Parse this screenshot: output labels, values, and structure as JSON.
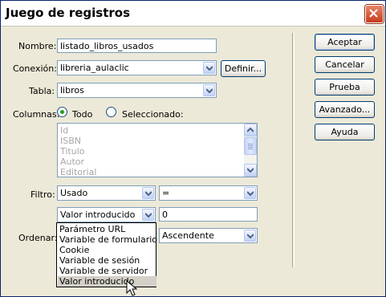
{
  "window": {
    "title": "Juego de registros"
  },
  "form": {
    "nombre": {
      "label": "Nombre:",
      "value": "listado_libros_usados"
    },
    "conexion": {
      "label": "Conexión:",
      "value": "libreria_aulaclic",
      "define_label": "Definir..."
    },
    "tabla": {
      "label": "Tabla:",
      "value": "libros"
    },
    "columnas": {
      "label": "Columnas:",
      "option_all": "Todo",
      "option_selected": "Seleccionado:",
      "selected_option": "Todo",
      "items": [
        "Id",
        "ISBN",
        "Titulo",
        "Autor",
        "Editorial"
      ]
    },
    "filtro": {
      "label": "Filtro:",
      "column": "Usado",
      "operator": "=",
      "source": "Valor introducido",
      "value": "0"
    },
    "ordenar": {
      "label": "Ordenar:",
      "direction": "Ascendente"
    }
  },
  "dropdown": {
    "items": [
      "Parámetro URL",
      "Variable de formulario",
      "Cookie",
      "Variable de sesión",
      "Variable de servidor",
      "Valor introducido"
    ],
    "highlighted": "Valor introducido"
  },
  "buttons": {
    "accept": "Aceptar",
    "cancel": "Cancelar",
    "test": "Prueba",
    "advanced": "Avanzado...",
    "help": "Ayuda"
  },
  "colors": {
    "title_border": "#0a246a",
    "dialog_bg": "#ece9d8",
    "close_red": "#c63b1d",
    "radio_green": "#21a121"
  }
}
